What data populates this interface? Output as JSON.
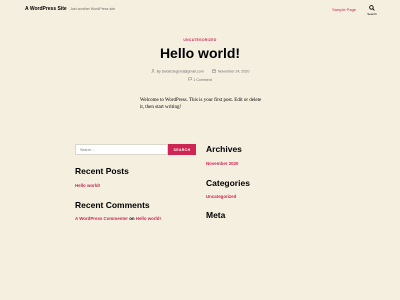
{
  "header": {
    "site_title": "A WordPress Site",
    "site_description": "Just another WordPress site",
    "nav_link": "Sample Page",
    "search_label": "Search"
  },
  "post": {
    "category": "UNCATEGORIZED",
    "title": "Hello world!",
    "author": "By Detail1legend@gmail.com",
    "date": "November 24, 2020",
    "comments": "1 Comment",
    "content": "Welcome to WordPress. This is your first post. Edit or delete it, then start writing!"
  },
  "sidebar": {
    "search": {
      "placeholder": "Search ...",
      "button": "SEARCH"
    },
    "recent_posts": {
      "title": "Recent Posts",
      "items": [
        "Hello world!"
      ]
    },
    "recent_comments": {
      "title": "Recent Comments",
      "author": "A WordPress Commenter",
      "on_text": "on",
      "post": "Hello world!"
    },
    "archives": {
      "title": "Archives",
      "items": [
        "November 2020"
      ]
    },
    "categories": {
      "title": "Categories",
      "items": [
        "Uncategorized"
      ]
    },
    "meta": {
      "title": "Meta"
    }
  },
  "colors": {
    "accent": "#cd2653",
    "background": "#f5efe0",
    "muted": "#6d6d6d"
  },
  "icons": [
    "search-icon",
    "user-icon",
    "calendar-icon",
    "comment-icon"
  ]
}
